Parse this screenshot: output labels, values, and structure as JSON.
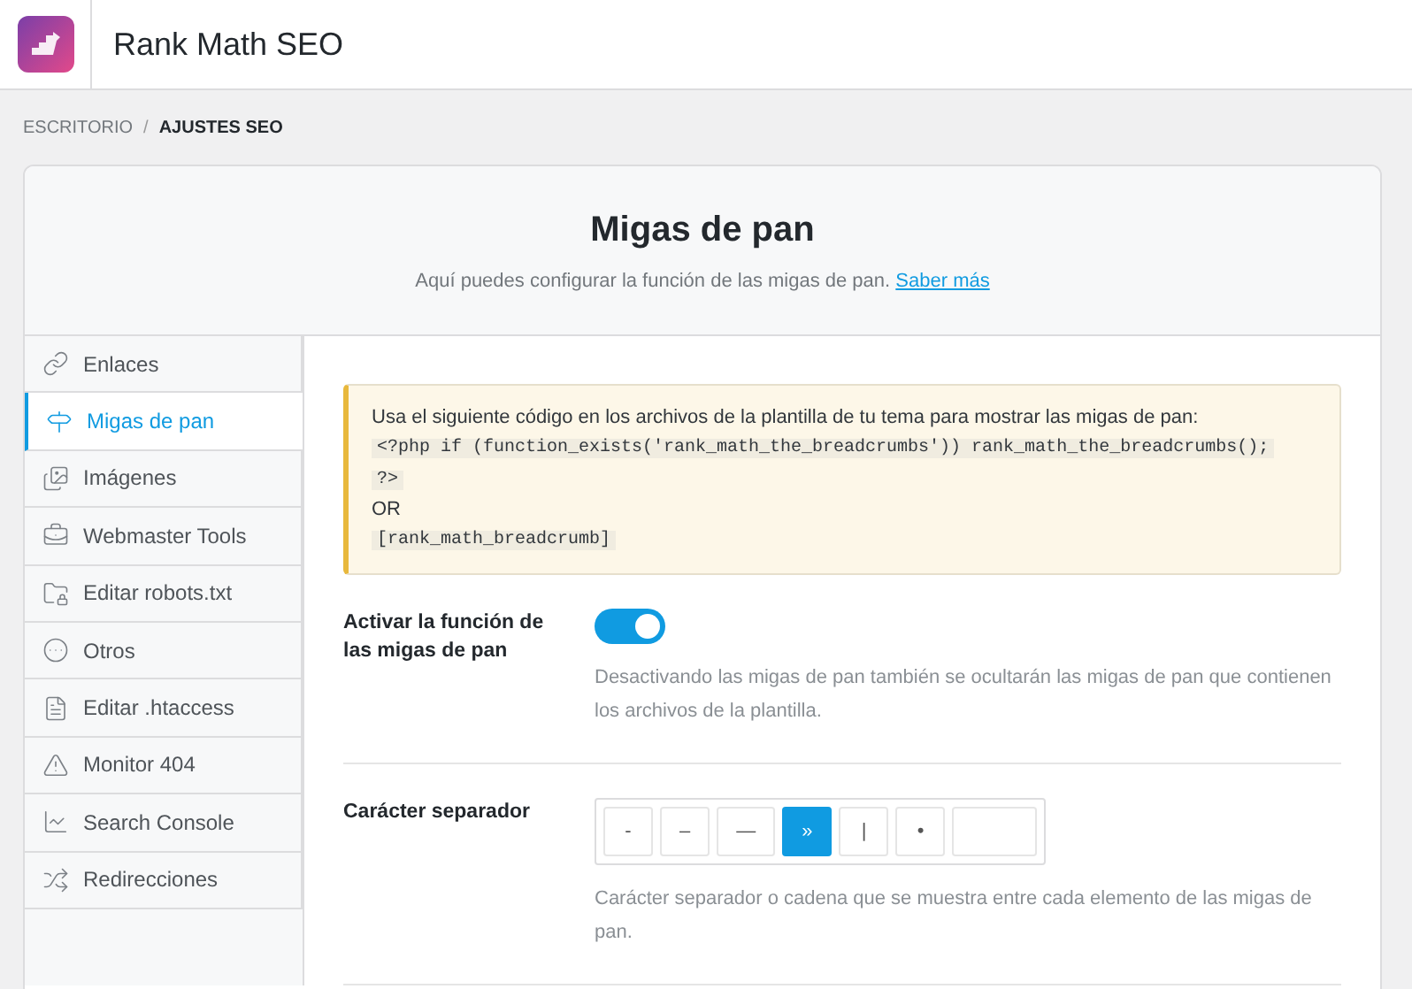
{
  "app": {
    "title": "Rank Math SEO"
  },
  "breadcrumb_separator": "/",
  "breadcrumb": [
    {
      "label": "ESCRITORIO",
      "current": false
    },
    {
      "label": "AJUSTES SEO",
      "current": true
    }
  ],
  "page": {
    "title": "Migas de pan",
    "subtitle": "Aquí puedes configurar la función de las migas de pan.",
    "link": "Saber más"
  },
  "sidebar": {
    "items": [
      {
        "label": "Enlaces",
        "selected": false
      },
      {
        "label": "Migas de pan",
        "selected": true
      },
      {
        "label": "Imágenes",
        "selected": false
      },
      {
        "label": "Webmaster Tools",
        "selected": false
      },
      {
        "label": "Editar robots.txt",
        "selected": false
      },
      {
        "label": "Otros",
        "selected": false
      },
      {
        "label": "Editar .htaccess",
        "selected": false
      },
      {
        "label": "Monitor 404",
        "selected": false
      },
      {
        "label": "Search Console",
        "selected": false
      },
      {
        "label": "Redirecciones",
        "selected": false
      }
    ]
  },
  "notice": {
    "text": "Usa el siguiente código en los archivos de la plantilla de tu tema para mostrar las migas de pan:",
    "code": [
      "<?php if (function_exists('rank_math_the_breadcrumbs')) rank_math_the_breadcrumbs();",
      "?>"
    ],
    "or": "OR",
    "shortcode": "[rank_math_breadcrumb]"
  },
  "settings": [
    {
      "kind": "toggle",
      "label": "Activar la función de las migas de pan",
      "on": true,
      "description": "Desactivando las migas de pan también se ocultarán las migas de pan que contienen los archivos de la plantilla."
    },
    {
      "kind": "separator",
      "label": "Carácter separador",
      "options": [
        {
          "kind": "char",
          "label": "-",
          "selected": false
        },
        {
          "kind": "char",
          "label": "–",
          "selected": false
        },
        {
          "kind": "char",
          "label": "—",
          "selected": false
        },
        {
          "kind": "char",
          "label": "»",
          "selected": true
        },
        {
          "kind": "char",
          "label": "|",
          "selected": false
        },
        {
          "kind": "char",
          "label": "•",
          "selected": false
        },
        {
          "kind": "custom",
          "selected": false
        }
      ],
      "description": "Carácter separador o cadena que se muestra entre cada elemento de las migas de pan."
    }
  ]
}
